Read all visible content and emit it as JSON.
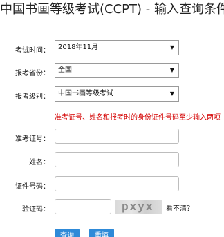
{
  "page": {
    "title": "中国书画等级考试(CCPT) - 输入查询条件"
  },
  "form": {
    "exam_time_label": "考试时间：",
    "exam_time_value": "2018年11月",
    "province_label": "报考省份：",
    "province_value": "全国",
    "level_label": "报考级别：",
    "level_value": "中国书画等级考试",
    "hint": "准考证号、姓名和报考时的身份证件号码至少输入两项",
    "admission_label": "准考证号：",
    "admission_value": "",
    "name_label": "姓名：",
    "name_value": "",
    "id_label": "证件号码：",
    "id_value": "",
    "captcha_label": "验证码：",
    "captcha_value": "",
    "captcha_text": "pxyx",
    "captcha_refresh": "看不清？"
  },
  "buttons": {
    "query": "查询",
    "reset": "重填"
  },
  "icons": {
    "dropdown": "chevron-down-icon"
  },
  "colors": {
    "accent": "#2e8ad8",
    "warning": "#d40000"
  }
}
